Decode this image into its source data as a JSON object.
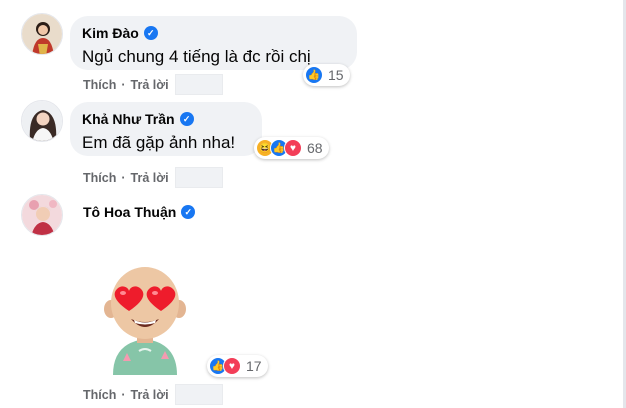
{
  "comments": [
    {
      "author": "Kim Đào",
      "text": "Ngủ chung 4 tiếng là đc rồi chị",
      "reaction_count": "15",
      "reactions": [
        "like-icon"
      ],
      "like_label": "Thích",
      "reply_label": "Trả lời"
    },
    {
      "author": "Khả Như Trần",
      "text": "Em đã gặp ảnh nha!",
      "reaction_count": "68",
      "reactions": [
        "haha-icon",
        "like-icon",
        "love-icon"
      ],
      "like_label": "Thích",
      "reply_label": "Trả lời"
    },
    {
      "author": "Tô Hoa Thuận",
      "text": "",
      "sticker": "heart-eyes-avatar-sticker",
      "reaction_count": "17",
      "reactions": [
        "like-icon",
        "love-icon"
      ],
      "like_label": "Thích",
      "reply_label": "Trả lời"
    }
  ],
  "colors": {
    "accent": "#1877f2",
    "bubble": "#f0f2f5",
    "love": "#f33e58",
    "haha": "#f7b125",
    "meta": "#65676b"
  }
}
